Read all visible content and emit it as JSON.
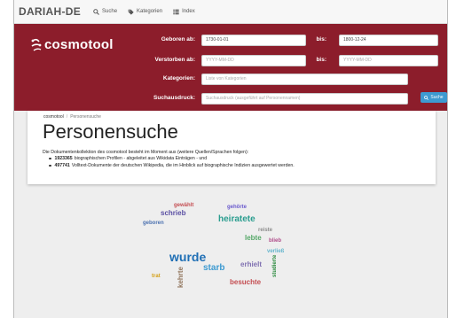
{
  "nav": {
    "brand": "DARIAH-DE",
    "links": [
      {
        "label": "Suche",
        "icon": "search-icon"
      },
      {
        "label": "Kategorien",
        "icon": "tag-icon"
      },
      {
        "label": "Index",
        "icon": "list-icon"
      }
    ]
  },
  "logo": {
    "text": "cosmotool"
  },
  "form": {
    "born_from_label": "Geboren ab:",
    "born_from_value": "1730-01-01",
    "born_to_label": "bis:",
    "born_to_value": "1800-12-24",
    "died_from_label": "Verstorben ab:",
    "died_from_placeholder": "YYYY-MM-DD",
    "died_to_label": "bis:",
    "died_to_placeholder": "YYYY-MM-DD",
    "categories_label": "Kategorien:",
    "categories_placeholder": "Liste von Kategorien",
    "query_label": "Suchausdruck:",
    "query_placeholder": "Suchausdruck (ausgeführt auf Personennamen)",
    "search_button": "Suche"
  },
  "breadcrumb": {
    "home": "cosmotool",
    "separator": "/",
    "current": "Personensuche"
  },
  "page_title": "Personensuche",
  "intro": "Die Dokumentenkollektion des cosmotool besteht im Moment aus (weitere Quellen/Sprachen folgen):",
  "bullets": [
    {
      "count": "1923365",
      "text": "biographischen Profilen - abgeleitet aus Wikidata Einträgen - und"
    },
    {
      "count": "497741",
      "text": "Volltext-Dokumente der deutschen Wikipedia, die im Hinblick auf biographische Indizien ausgewertet werden."
    }
  ],
  "colors": {
    "banner": "#8c1d2b",
    "accent": "#3d9ad1"
  },
  "wordcloud": {
    "words": [
      {
        "text": "wurde",
        "color": "#1f6fb5",
        "weight": 5
      },
      {
        "text": "heiratete",
        "color": "#2a9d8f",
        "weight": 4
      },
      {
        "text": "starb",
        "color": "#3d9ad1",
        "weight": 4
      },
      {
        "text": "schrieb",
        "color": "#5a4fa3",
        "weight": 3
      },
      {
        "text": "besuchte",
        "color": "#c44e52",
        "weight": 3
      },
      {
        "text": "erhielt",
        "color": "#8172b2",
        "weight": 3
      },
      {
        "text": "kehrte",
        "color": "#937860",
        "weight": 3
      },
      {
        "text": "lebte",
        "color": "#55a868",
        "weight": 3
      },
      {
        "text": "gewählt",
        "color": "#c44e52",
        "weight": 2
      },
      {
        "text": "geboren",
        "color": "#4c72b0",
        "weight": 2
      },
      {
        "text": "reiste",
        "color": "#8c8c8c",
        "weight": 2
      },
      {
        "text": "verließ",
        "color": "#64b5cd",
        "weight": 2
      },
      {
        "text": "blieb",
        "color": "#b04c8a",
        "weight": 2
      },
      {
        "text": "gehörte",
        "color": "#6a5acd",
        "weight": 2
      },
      {
        "text": "studierte",
        "color": "#2b8a3e",
        "weight": 2
      },
      {
        "text": "trat",
        "color": "#d4a017",
        "weight": 2
      }
    ]
  }
}
